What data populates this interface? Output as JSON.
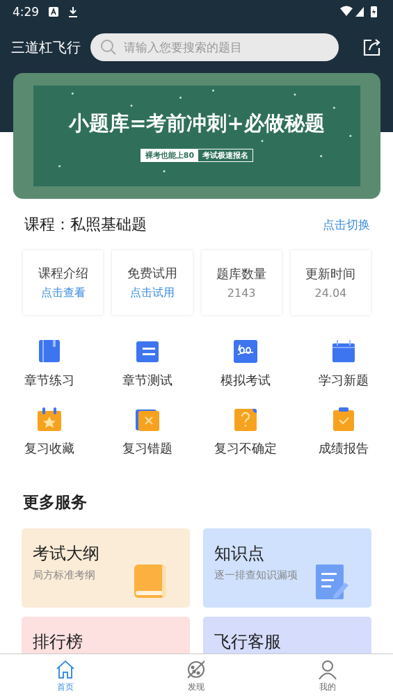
{
  "status_bar": {
    "time": "4:29"
  },
  "header": {
    "title": "三道杠飞行",
    "search": {
      "placeholder": "请输入您要搜索的题目"
    }
  },
  "banner": {
    "headline": "小题库=考前冲刺+必做秘题",
    "tag_left": "裸考也能上80",
    "tag_right": "考试极速报名"
  },
  "course": {
    "label": "课程：私照基础题",
    "switch": "点击切换"
  },
  "stats": [
    {
      "title": "课程介绍",
      "value": "点击查看",
      "kind": "link"
    },
    {
      "title": "免费试用",
      "value": "点击试用",
      "kind": "link"
    },
    {
      "title": "题库数量",
      "value": "2143",
      "kind": "number"
    },
    {
      "title": "更新时间",
      "value": "24.04",
      "kind": "number"
    }
  ],
  "features": [
    {
      "label": "章节练习",
      "kind": "book"
    },
    {
      "label": "章节测试",
      "kind": "list"
    },
    {
      "label": "模拟考试",
      "kind": "score"
    },
    {
      "label": "学习新题",
      "kind": "calendar"
    },
    {
      "label": "复习收藏",
      "kind": "star"
    },
    {
      "label": "复习错题",
      "kind": "cross"
    },
    {
      "label": "复习不确定",
      "kind": "question"
    },
    {
      "label": "成绩报告",
      "kind": "check"
    }
  ],
  "more_services": {
    "title": "更多服务",
    "cards": [
      {
        "title": "考试大纲",
        "subtitle": "局方标准考纲",
        "color": "#fbecd7",
        "kind": "book"
      },
      {
        "title": "知识点",
        "subtitle": "逐一排查知识漏项",
        "color": "#cfe1fd",
        "kind": "note"
      },
      {
        "title": "排行榜",
        "color": "#fde0e0"
      },
      {
        "title": "飞行客服",
        "color": "#d5dcfc"
      }
    ]
  },
  "tabs": [
    {
      "label": "首页",
      "selected": true,
      "kind": "home"
    },
    {
      "label": "发现",
      "selected": false,
      "kind": "planet"
    },
    {
      "label": "我的",
      "selected": false,
      "kind": "user"
    }
  ]
}
